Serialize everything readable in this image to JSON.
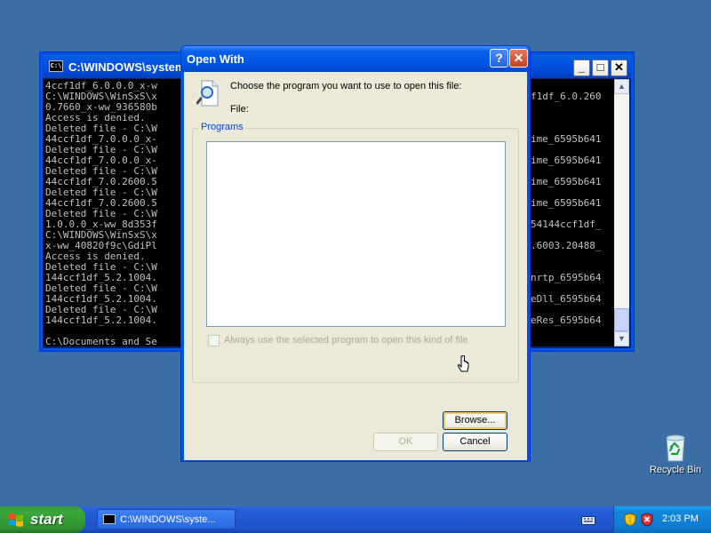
{
  "console": {
    "title": "C:\\WINDOWS\\system",
    "left_lines": [
      "4ccf1df_6.0.0.0_x-w",
      "C:\\WINDOWS\\WinSxS\\x",
      "0.7660_x-ww_936580b",
      "Access is denied.",
      "Deleted file - C:\\W",
      "44ccf1df_7.0.0.0_x-",
      "Deleted file - C:\\W",
      "44ccf1df_7.0.0.0_x-",
      "Deleted file - C:\\W",
      "44ccf1df_7.0.2600.5",
      "Deleted file - C:\\W",
      "44ccf1df_7.0.2600.5",
      "Deleted file - C:\\W",
      "1.0.0.0_x-ww_8d353f",
      "C:\\WINDOWS\\WinSxS\\x",
      "x-ww_40820f9c\\GdiPl",
      "Access is denied.",
      "Deleted file - C:\\W",
      "144ccf1df_5.2.1004.",
      "Deleted file - C:\\W",
      "144ccf1df_5.2.1004.",
      "Deleted file - C:\\W",
      "144ccf1df_5.2.1004.",
      "",
      "C:\\Documents and Se"
    ],
    "right_lines": [
      "",
      "f1df_6.0.260",
      "",
      "",
      "",
      "ime_6595b641",
      "",
      "ime_6595b641",
      "",
      "ime_6595b641",
      "",
      "ime_6595b641",
      "",
      "54144ccf1df_",
      "",
      ".6003.20488_",
      "",
      "",
      "nrtp_6595b64",
      "",
      "eDll_6595b64",
      "",
      "eRes_6595b64",
      "",
      ""
    ]
  },
  "dialog": {
    "title": "Open With",
    "help_label": "?",
    "close_label": "✕",
    "prompt": "Choose the program you want to use to open this file:",
    "file_label": "File:",
    "programs_label": "Programs",
    "always_use_label": "Always use the selected program to open this kind of file",
    "browse_label": "Browse...",
    "ok_label": "OK",
    "cancel_label": "Cancel"
  },
  "desktop": {
    "recycle_bin_label": "Recycle Bin"
  },
  "taskbar": {
    "start_label": "start",
    "task_item_label": "C:\\WINDOWS\\syste...",
    "clock": "2:03 PM"
  },
  "icons": {
    "console": "console-icon",
    "search": "search-document-icon",
    "recycle": "recycle-bin-icon",
    "start": "windows-logo-icon",
    "keyboard": "keyboard-icon",
    "security": "security-shield-icon",
    "cursor": "mouse-cursor-icon"
  },
  "colors": {
    "desktop": "#3a6ea5",
    "titlebar": "#0054e3",
    "dialog_bg": "#ece9d8",
    "group_label": "#0046d5"
  }
}
